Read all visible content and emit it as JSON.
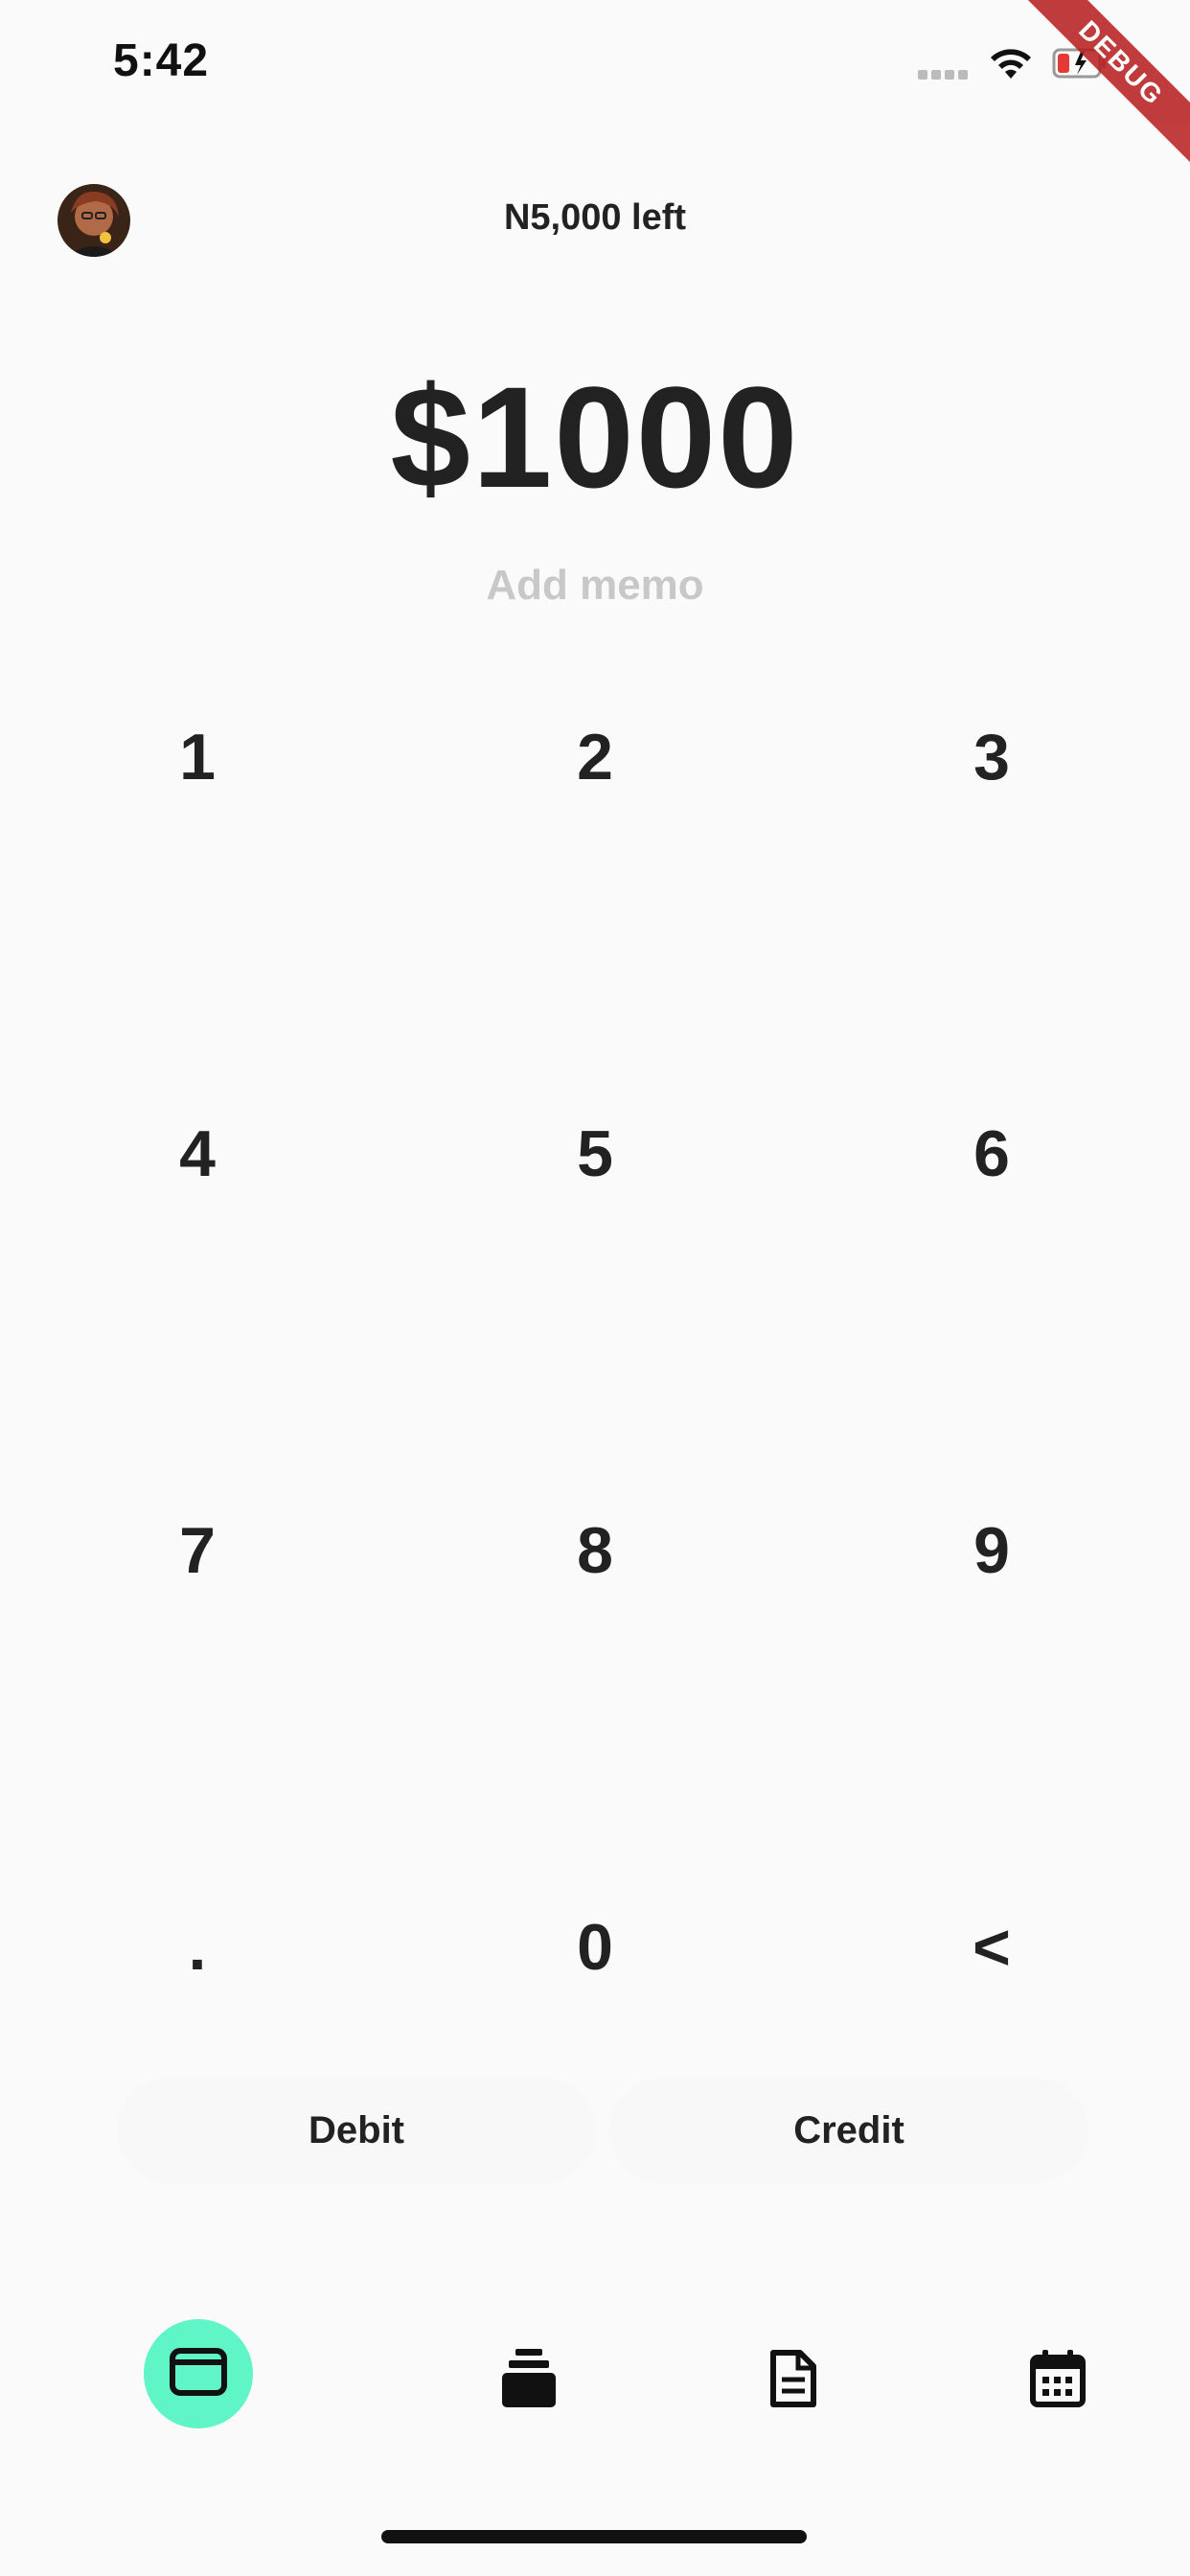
{
  "status_bar": {
    "time": "5:42"
  },
  "debug_banner": "DEBUG",
  "header": {
    "budget_left": "N5,000 left"
  },
  "amount": "$1000",
  "memo_placeholder": "Add memo",
  "keypad": {
    "keys": [
      "1",
      "2",
      "3",
      "4",
      "5",
      "6",
      "7",
      "8",
      "9",
      ".",
      "0",
      "<"
    ]
  },
  "actions": {
    "debit_label": "Debit",
    "credit_label": "Credit"
  },
  "bottom_nav": {
    "items": [
      {
        "icon": "wallet-icon",
        "active": true
      },
      {
        "icon": "stack-icon",
        "active": false
      },
      {
        "icon": "document-icon",
        "active": false
      },
      {
        "icon": "calendar-icon",
        "active": false
      }
    ]
  },
  "colors": {
    "accent": "#5ff5c6",
    "text": "#222222",
    "placeholder": "#c8c8c8",
    "background": "#fafafa",
    "debug": "#b71c1c"
  }
}
